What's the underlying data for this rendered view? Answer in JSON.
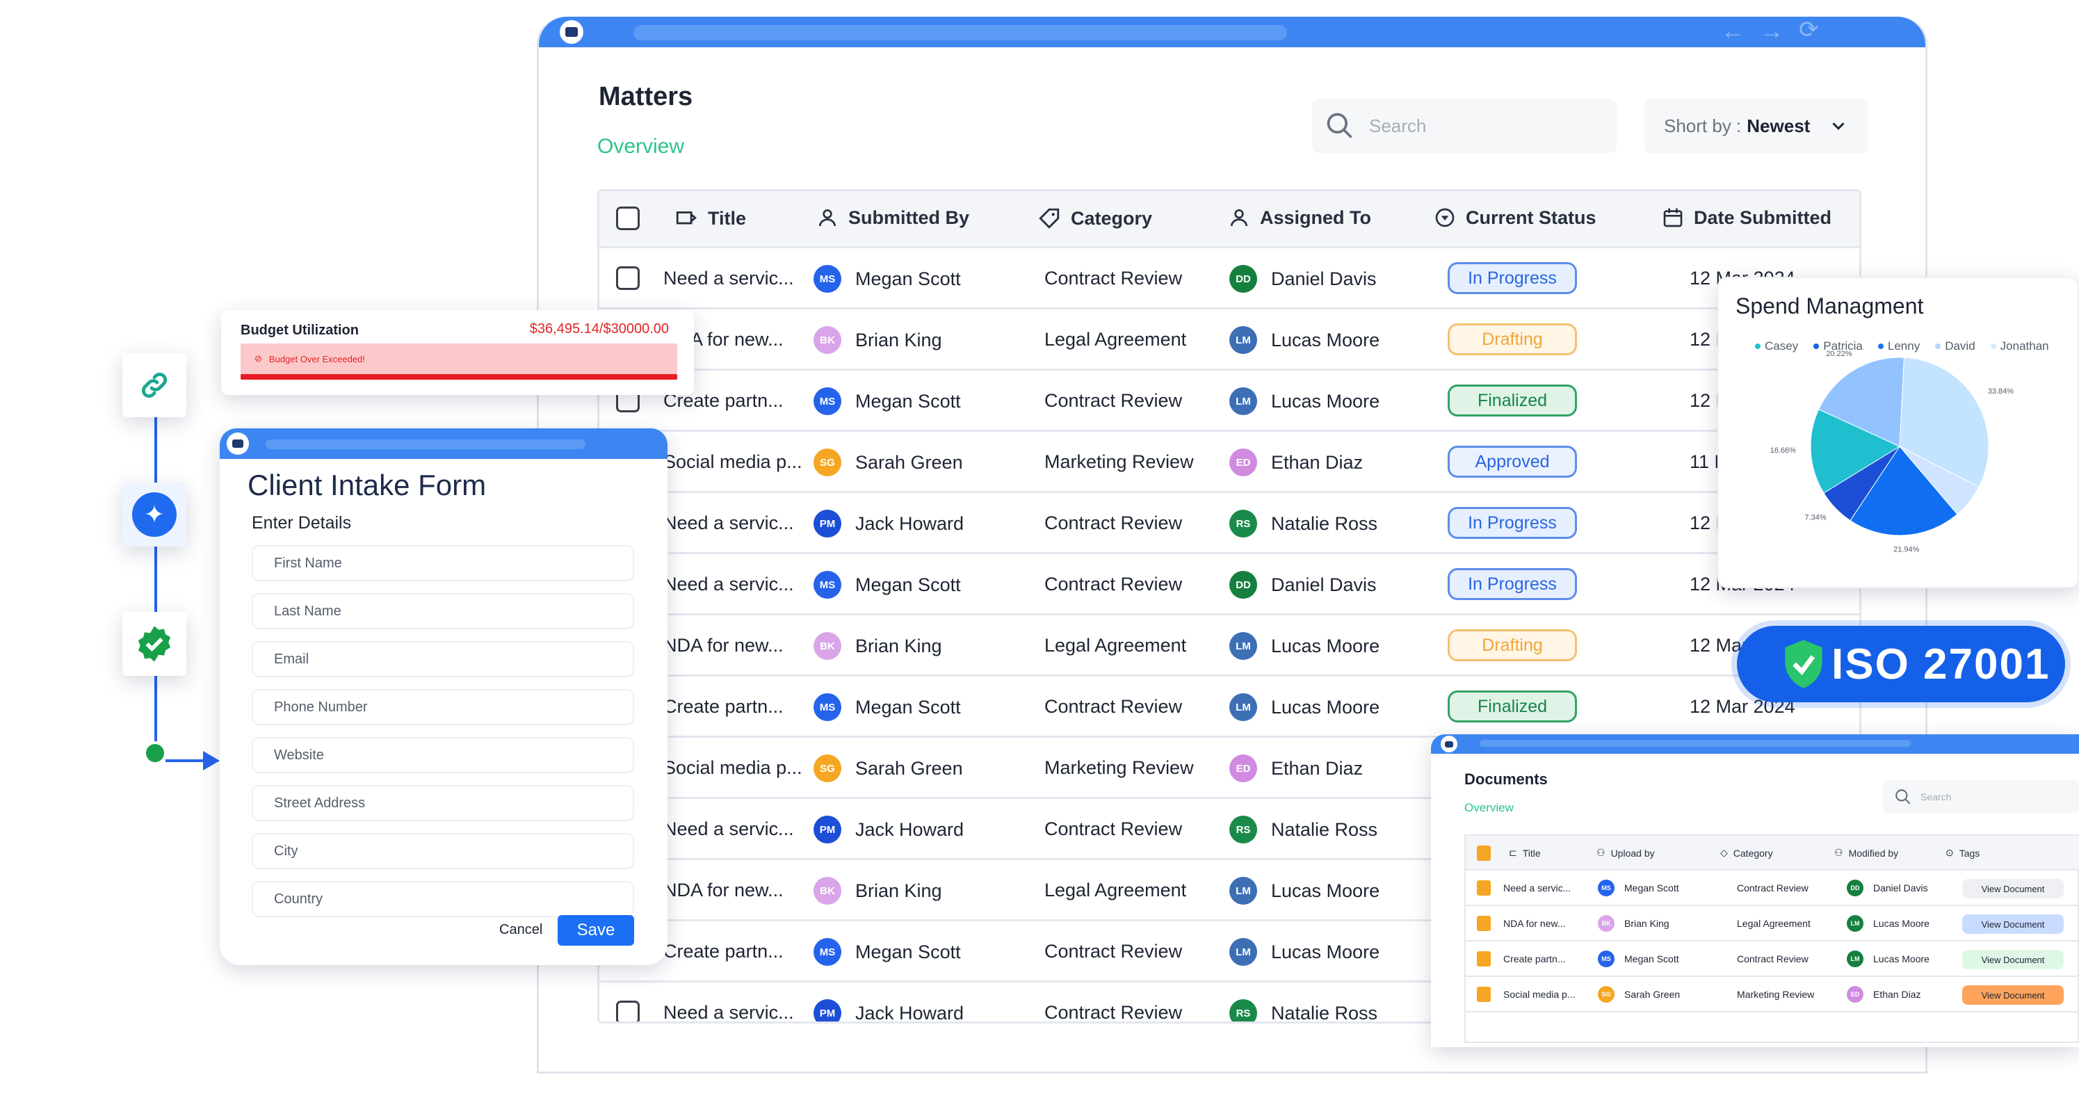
{
  "matters": {
    "title": "Matters",
    "subtitle": "Overview",
    "search_placeholder": "Search",
    "sort_prefix": "Short by :",
    "sort_value": "Newest",
    "columns": [
      "Title",
      "Submitted By",
      "Category",
      "Assigned To",
      "Current Status",
      "Date Submitted"
    ],
    "rows": [
      {
        "title": "Need a servic...",
        "sub_initials": "MS",
        "sub_name": "Megan Scott",
        "category": "Contract Review",
        "asg_initials": "DD",
        "asg_name": "Daniel Davis",
        "status": "In Progress",
        "date": "12 Mar 2024"
      },
      {
        "title": "NDA for new...",
        "sub_initials": "BK",
        "sub_name": "Brian King",
        "category": "Legal Agreement",
        "asg_initials": "LM",
        "asg_name": "Lucas Moore",
        "status": "Drafting",
        "date": "12 Mar 2024"
      },
      {
        "title": "Create partn...",
        "sub_initials": "MS",
        "sub_name": "Megan Scott",
        "category": "Contract Review",
        "asg_initials": "LM",
        "asg_name": "Lucas Moore",
        "status": "Finalized",
        "date": "12 Mar 2024"
      },
      {
        "title": "Social media p...",
        "sub_initials": "SG",
        "sub_name": "Sarah Green",
        "category": "Marketing Review",
        "asg_initials": "ED",
        "asg_name": "Ethan Diaz",
        "status": "Approved",
        "date": "11 Mar 2024"
      },
      {
        "title": "Need a servic...",
        "sub_initials": "PM",
        "sub_name": "Jack Howard",
        "category": "Contract Review",
        "asg_initials": "RS",
        "asg_name": "Natalie Ross",
        "status": "In Progress",
        "date": "12 Mar 2024"
      },
      {
        "title": "Need a servic...",
        "sub_initials": "MS",
        "sub_name": "Megan Scott",
        "category": "Contract Review",
        "asg_initials": "DD",
        "asg_name": "Daniel Davis",
        "status": "In Progress",
        "date": "12 Mar 2024"
      },
      {
        "title": "NDA for new...",
        "sub_initials": "BK",
        "sub_name": "Brian King",
        "category": "Legal Agreement",
        "asg_initials": "LM",
        "asg_name": "Lucas Moore",
        "status": "Drafting",
        "date": "12 Mar 2024"
      },
      {
        "title": "Create partn...",
        "sub_initials": "MS",
        "sub_name": "Megan Scott",
        "category": "Contract Review",
        "asg_initials": "LM",
        "asg_name": "Lucas Moore",
        "status": "Finalized",
        "date": "12 Mar 2024"
      },
      {
        "title": "Social media p...",
        "sub_initials": "SG",
        "sub_name": "Sarah Green",
        "category": "Marketing Review",
        "asg_initials": "ED",
        "asg_name": "Ethan Diaz",
        "status": "",
        "date": ""
      },
      {
        "title": "Need a servic...",
        "sub_initials": "PM",
        "sub_name": "Jack Howard",
        "category": "Contract Review",
        "asg_initials": "RS",
        "asg_name": "Natalie Ross",
        "status": "",
        "date": ""
      },
      {
        "title": "NDA for new...",
        "sub_initials": "BK",
        "sub_name": "Brian King",
        "category": "Legal Agreement",
        "asg_initials": "LM",
        "asg_name": "Lucas Moore",
        "status": "",
        "date": ""
      },
      {
        "title": "Create partn...",
        "sub_initials": "MS",
        "sub_name": "Megan Scott",
        "category": "Contract Review",
        "asg_initials": "LM",
        "asg_name": "Lucas Moore",
        "status": "",
        "date": ""
      },
      {
        "title": "Need a servic...",
        "sub_initials": "PM",
        "sub_name": "Jack Howard",
        "category": "Contract Review",
        "asg_initials": "RS",
        "asg_name": "Natalie Ross",
        "status": "",
        "date": ""
      }
    ]
  },
  "avatar_colors": {
    "MS": "#2563eb",
    "BK": "#d9a5e8",
    "SG": "#f5a623",
    "PM": "#1d4ed8",
    "DD": "#15803d",
    "LM": "#3d6fb5",
    "ED": "#d08be0",
    "RS": "#1a8a4a"
  },
  "asg_colors": {
    "DD": "#15803d",
    "LM": "#15803d",
    "ED": "#d08be0",
    "RS": "#1a8a4a"
  },
  "budget": {
    "title": "Budget Utilization",
    "amount": "$36,495.14/$30000.00",
    "warning": "Budget Over Exceeded!"
  },
  "intake": {
    "title": "Client Intake Form",
    "subtitle": "Enter Details",
    "fields": [
      "First Name",
      "Last Name",
      "Email",
      "Phone Number",
      "Website",
      "Street Address",
      "City",
      "Country"
    ],
    "cancel": "Cancel",
    "save": "Save"
  },
  "spend": {
    "title": "Spend Managment"
  },
  "iso": {
    "label": "ISO 27001"
  },
  "documents": {
    "title": "Documents",
    "subtitle": "Overview",
    "search_placeholder": "Search",
    "columns": [
      "Title",
      "Upload by",
      "Category",
      "Modified by",
      "Tags"
    ],
    "rows": [
      {
        "title": "Need a servic...",
        "up_initials": "MS",
        "up_name": "Megan Scott",
        "category": "Contract Review",
        "mod_initials": "DD",
        "mod_name": "Daniel Davis",
        "tag": "View Document",
        "tag_color": "#eef0f3",
        "tag_text": "#1e2433"
      },
      {
        "title": "NDA for new...",
        "up_initials": "BK",
        "up_name": "Brian King",
        "category": "Legal Agreement",
        "mod_initials": "LM",
        "mod_name": "Lucas Moore",
        "tag": "View Document",
        "tag_color": "#c9dbff",
        "tag_text": "#1e2433"
      },
      {
        "title": "Create partn...",
        "up_initials": "MS",
        "up_name": "Megan Scott",
        "category": "Contract Review",
        "mod_initials": "LM",
        "mod_name": "Lucas Moore",
        "tag": "View Document",
        "tag_color": "#dff7e6",
        "tag_text": "#1e2433"
      },
      {
        "title": "Social media p...",
        "up_initials": "SG",
        "up_name": "Sarah Green",
        "category": "Marketing Review",
        "mod_initials": "ED",
        "mod_name": "Ethan Diaz",
        "tag": "View Document",
        "tag_color": "#ffa35c",
        "tag_text": "#1e2433"
      }
    ]
  },
  "chart_data": {
    "type": "pie",
    "title": "Spend Managment",
    "legend": [
      "Casey",
      "Patricia",
      "Lenny",
      "David",
      "Jonathan"
    ],
    "legend_colors": [
      "#1fc3cf",
      "#1a5fe6",
      "#1a73f0",
      "#b9d7ff",
      "#d6ebff"
    ],
    "legend_placement": "top",
    "slices": [
      {
        "label": "33.84%",
        "value": 33.84,
        "color": "#c3e3ff"
      },
      {
        "label": "",
        "value": 6.7,
        "color": "#d0e4ff"
      },
      {
        "label": "21.94%",
        "value": 21.94,
        "color": "#0f6ff0"
      },
      {
        "label": "7.34%",
        "value": 7.34,
        "color": "#1c4fd6"
      },
      {
        "label": "16.66%",
        "value": 16.66,
        "color": "#1fbfd0"
      },
      {
        "label": "20.22%",
        "value": 20.22,
        "color": "#93c3ff"
      }
    ]
  }
}
